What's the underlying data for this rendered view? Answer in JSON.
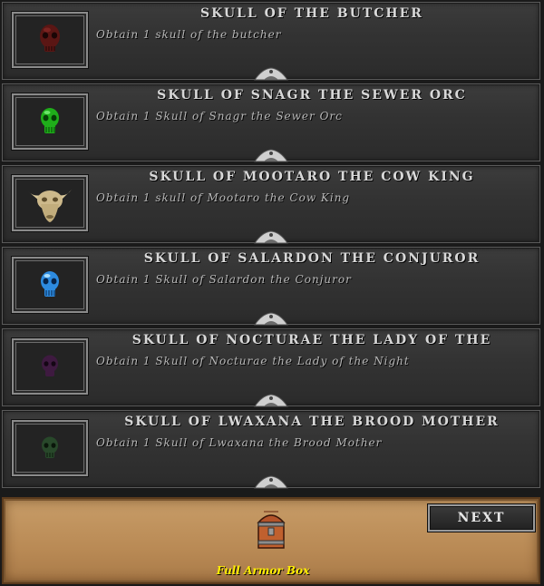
{
  "quests": [
    {
      "title": "SKULL OF THE BUTCHER",
      "description": "Obtain 1 skull of the butcher",
      "icon": "dark-red-skull-icon",
      "icon_color": "#6b1c1a"
    },
    {
      "title": "SKULL OF SNAGR THE SEWER ORC",
      "description": "Obtain 1 Skull of Snagr the Sewer Orc",
      "icon": "green-skull-icon",
      "icon_color": "#22c020"
    },
    {
      "title": "SKULL OF MOOTARO THE COW KING",
      "description": "Obtain 1 skull of Mootaro the Cow King",
      "icon": "cow-skull-icon",
      "icon_color": "#c8b585"
    },
    {
      "title": "SKULL OF SALARDON THE CONJUROR",
      "description": "Obtain 1 Skull of Salardon the Conjuror",
      "icon": "blue-skull-icon",
      "icon_color": "#3aa0f0"
    },
    {
      "title": "SKULL OF NOCTURAE THE LADY OF THE",
      "description": "Obtain 1 Skull of Nocturae the Lady of the Night",
      "icon": "purple-skull-icon",
      "icon_color": "#4a1e4a"
    },
    {
      "title": "SKULL OF LWAXANA THE BROOD MOTHER",
      "description": "Obtain 1 Skull of Lwaxana the Brood Mother",
      "icon": "dark-green-skull-icon",
      "icon_color": "#2a4a2a"
    }
  ],
  "reward": {
    "label": "Full Armor Box",
    "icon": "treasure-chest-icon"
  },
  "next_label": "NEXT"
}
